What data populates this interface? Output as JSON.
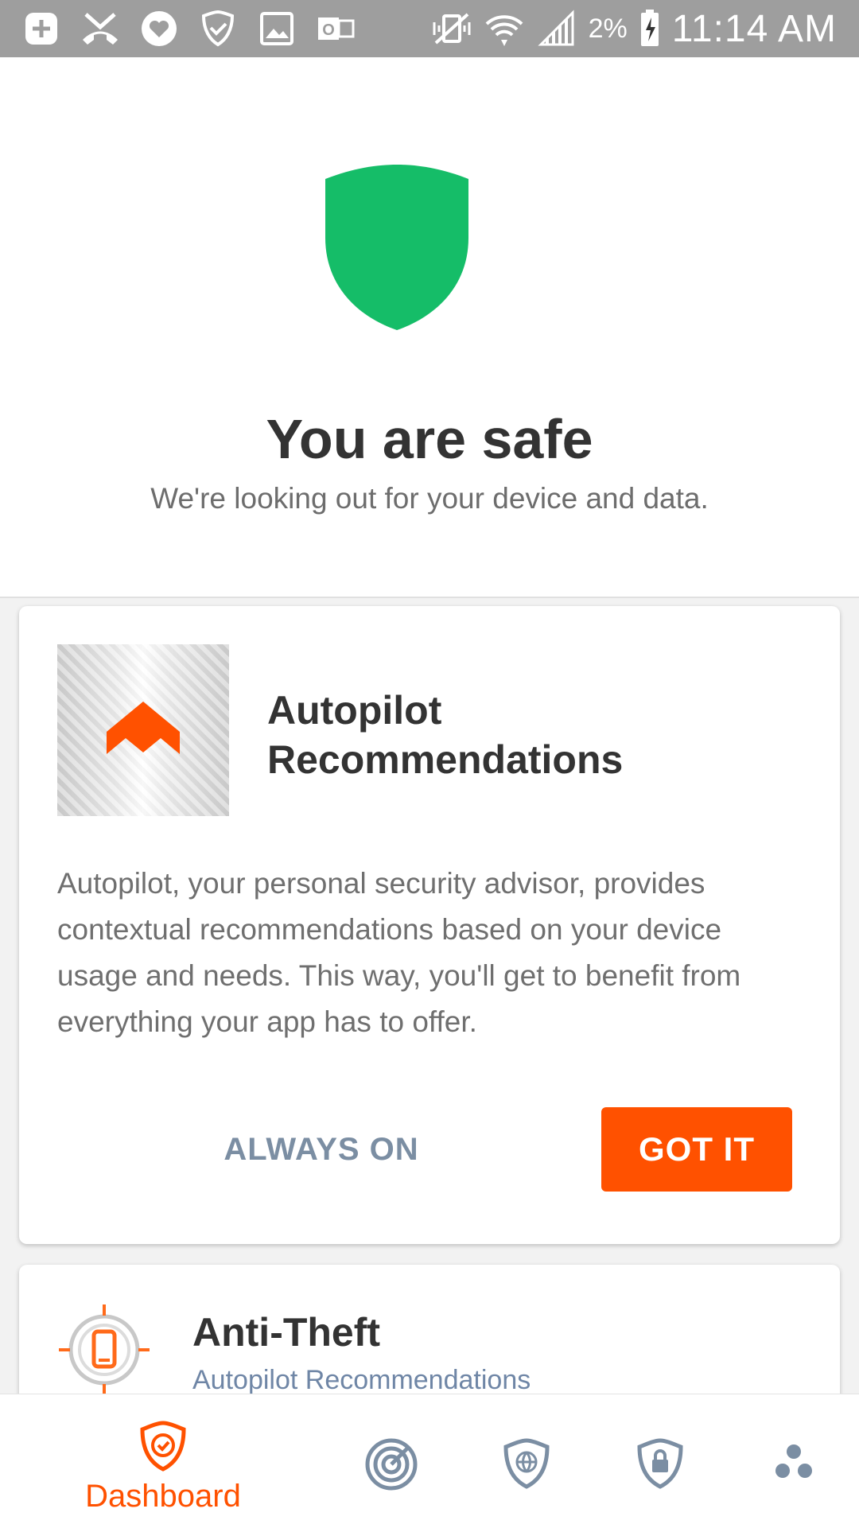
{
  "status_bar": {
    "battery_percent": "2%",
    "time": "11:14 AM",
    "icons": [
      "add-box-icon",
      "missed-call-icon",
      "heart-icon",
      "shield-check-icon",
      "image-icon",
      "outlook-icon",
      "vibrate-icon",
      "wifi-icon",
      "signal-icon",
      "battery-charging-icon"
    ]
  },
  "hero": {
    "title": "You are safe",
    "subtitle": "We're looking out for your device and data.",
    "shield_color": "#15bd68"
  },
  "autopilot_card": {
    "title": "Autopilot Recommendations",
    "body": "Autopilot, your personal security advisor, provides contextual recommendations based on your device usage and needs. This way, you'll get to benefit from everything your app has to offer.",
    "secondary_button": "ALWAYS ON",
    "primary_button": "GOT IT",
    "accent_color": "#ff5100"
  },
  "anti_theft_card": {
    "title": "Anti-Theft",
    "subtitle": "Autopilot Recommendations"
  },
  "bottom_nav": {
    "items": [
      {
        "label": "Dashboard",
        "icon": "shield-check-icon",
        "active": true
      },
      {
        "label": "",
        "icon": "radar-icon"
      },
      {
        "label": "",
        "icon": "web-protection-icon"
      },
      {
        "label": "",
        "icon": "privacy-lock-icon"
      },
      {
        "label": "",
        "icon": "more-dots-icon"
      }
    ]
  }
}
